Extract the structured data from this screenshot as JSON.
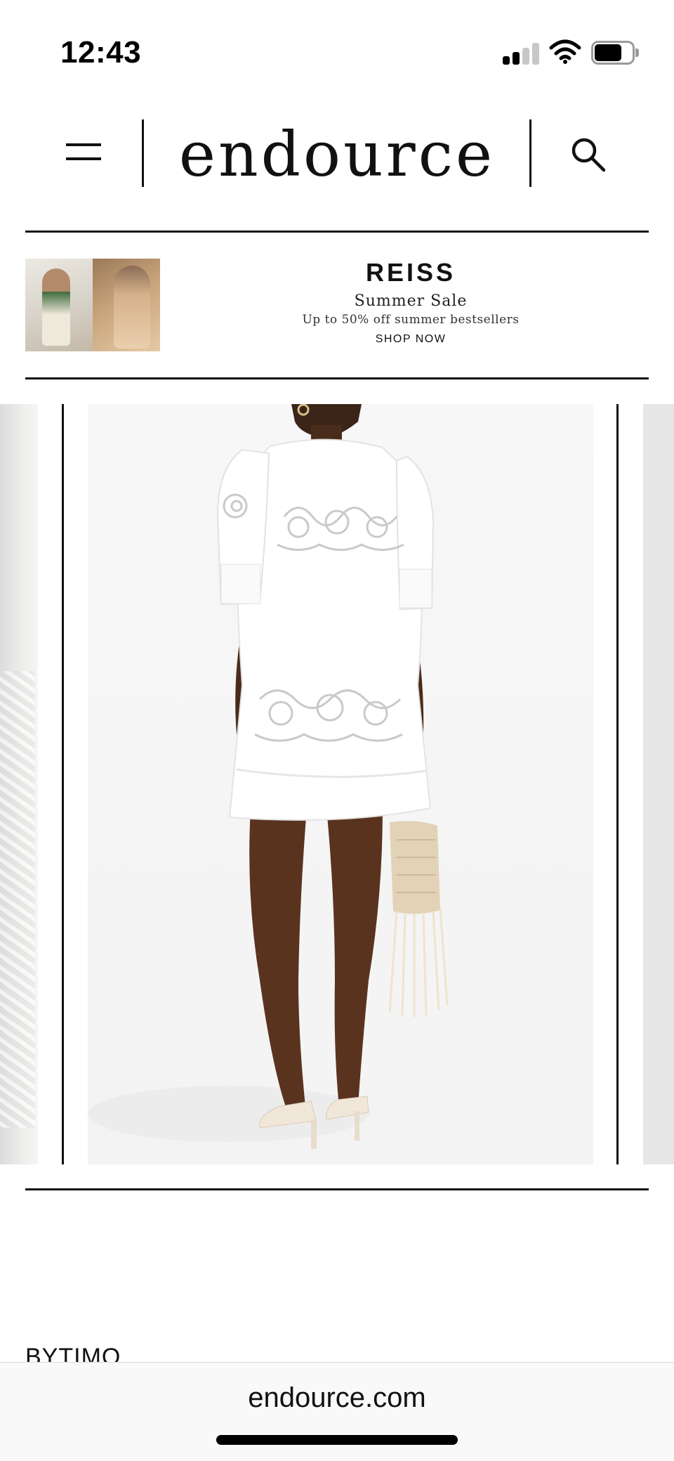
{
  "status_bar": {
    "time": "12:43",
    "icons": [
      "cellular-signal-icon",
      "wifi-icon",
      "battery-icon"
    ],
    "signal_bars_active": 2,
    "signal_bars_total": 4,
    "battery_level": 0.7
  },
  "header": {
    "logo": "endource",
    "menu_icon": "hamburger-menu-icon",
    "search_icon": "search-icon"
  },
  "ad": {
    "brand": "REISS",
    "title": "Summer Sale",
    "subtitle": "Up to 50% off summer bestsellers",
    "cta": "SHOP NOW"
  },
  "product": {
    "image_subject": "white embroidered mini dress with crochet bag"
  },
  "section": {
    "title": "BYTIMO"
  },
  "browser": {
    "url": "endource.com"
  },
  "colors": {
    "text": "#111111",
    "background": "#ffffff",
    "browser_bar": "#f9f9f9"
  }
}
